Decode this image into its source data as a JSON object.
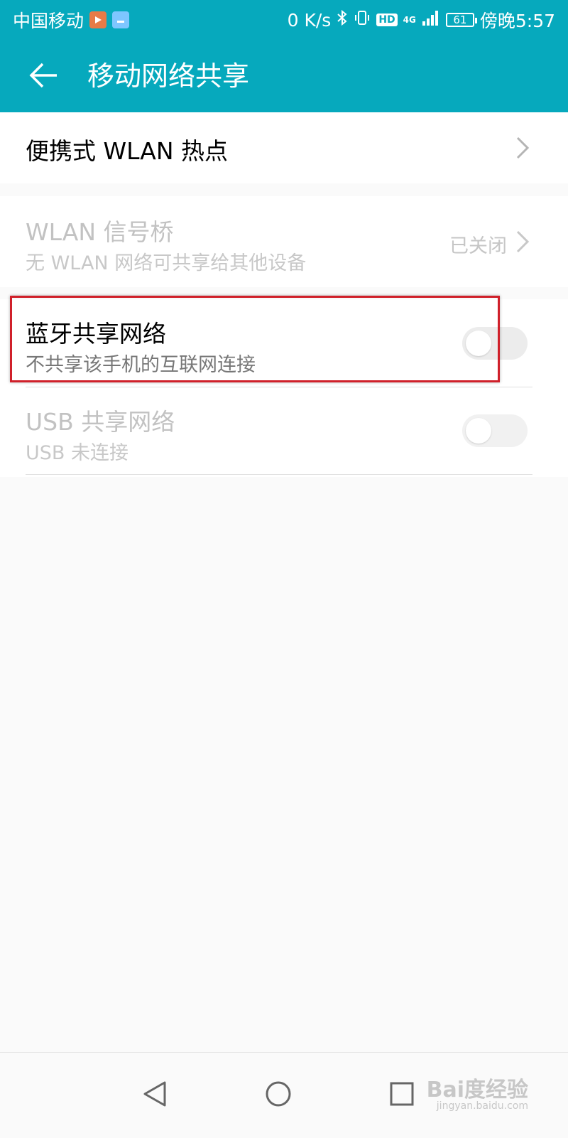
{
  "status_bar": {
    "carrier": "中国移动",
    "speed": "0 K/s",
    "hd": "HD",
    "network": "4G",
    "battery": "61",
    "time": "傍晚5:57"
  },
  "header": {
    "title": "移动网络共享"
  },
  "rows": {
    "wlan_hotspot": {
      "title": "便携式 WLAN 热点"
    },
    "wlan_bridge": {
      "title": "WLAN 信号桥",
      "subtitle": "无 WLAN 网络可共享给其他设备",
      "status": "已关闭"
    },
    "bluetooth_tethering": {
      "title": "蓝牙共享网络",
      "subtitle": "不共享该手机的互联网连接",
      "enabled": false
    },
    "usb_tethering": {
      "title": "USB 共享网络",
      "subtitle": "USB 未连接",
      "enabled": false
    }
  },
  "watermark": {
    "brand": "Bai度经验",
    "url": "jingyan.baidu.com"
  },
  "colors": {
    "accent": "#06a9bd",
    "highlight": "#d0202a"
  }
}
